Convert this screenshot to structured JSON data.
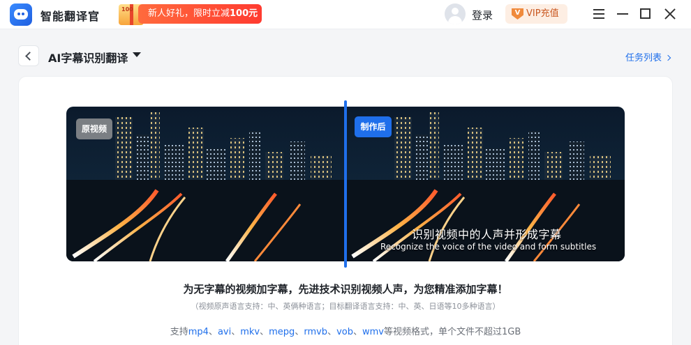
{
  "app": {
    "name": "智能翻译官"
  },
  "promo": {
    "gift_tag": "100",
    "text_prefix": "新人好礼，限时立减",
    "text_amount": "100元"
  },
  "header": {
    "login": "登录",
    "vip_badge": "V",
    "vip_label": "VIP充值"
  },
  "page": {
    "title": "AI字幕识别翻译",
    "task_list": "任务列表"
  },
  "preview": {
    "tag_original": "原视频",
    "tag_after": "制作后",
    "subtitle_cn": "识别视频中的人声并形成字幕",
    "subtitle_en": "Recognize the voice of the video and form subtitles"
  },
  "info": {
    "headline": "为无字幕的视频加字幕，先进技术识别视频人声，为您精准添加字幕！",
    "languages": "（视频原声语言支持：中、英俩种语言；目标翻译语言支持：中、英、日语等10多种语言）",
    "formats_prefix": "支持",
    "formats": [
      "mp4",
      "avi",
      "mkv",
      "mepg",
      "rmvb",
      "vob",
      "wmv"
    ],
    "formats_separator": "、",
    "formats_suffix": "等视频格式，单个文件不超过1GB"
  },
  "colors": {
    "accent": "#1f6feb",
    "promo": "#ff3b30",
    "vip": "#c9571f"
  },
  "icons": [
    "app-logo-icon",
    "gift-icon",
    "user-avatar-icon",
    "vip-crown-icon",
    "back-chevron-icon",
    "caret-down-icon",
    "chevron-right-icon",
    "menu-icon",
    "minimize-icon",
    "maximize-icon",
    "close-icon"
  ]
}
